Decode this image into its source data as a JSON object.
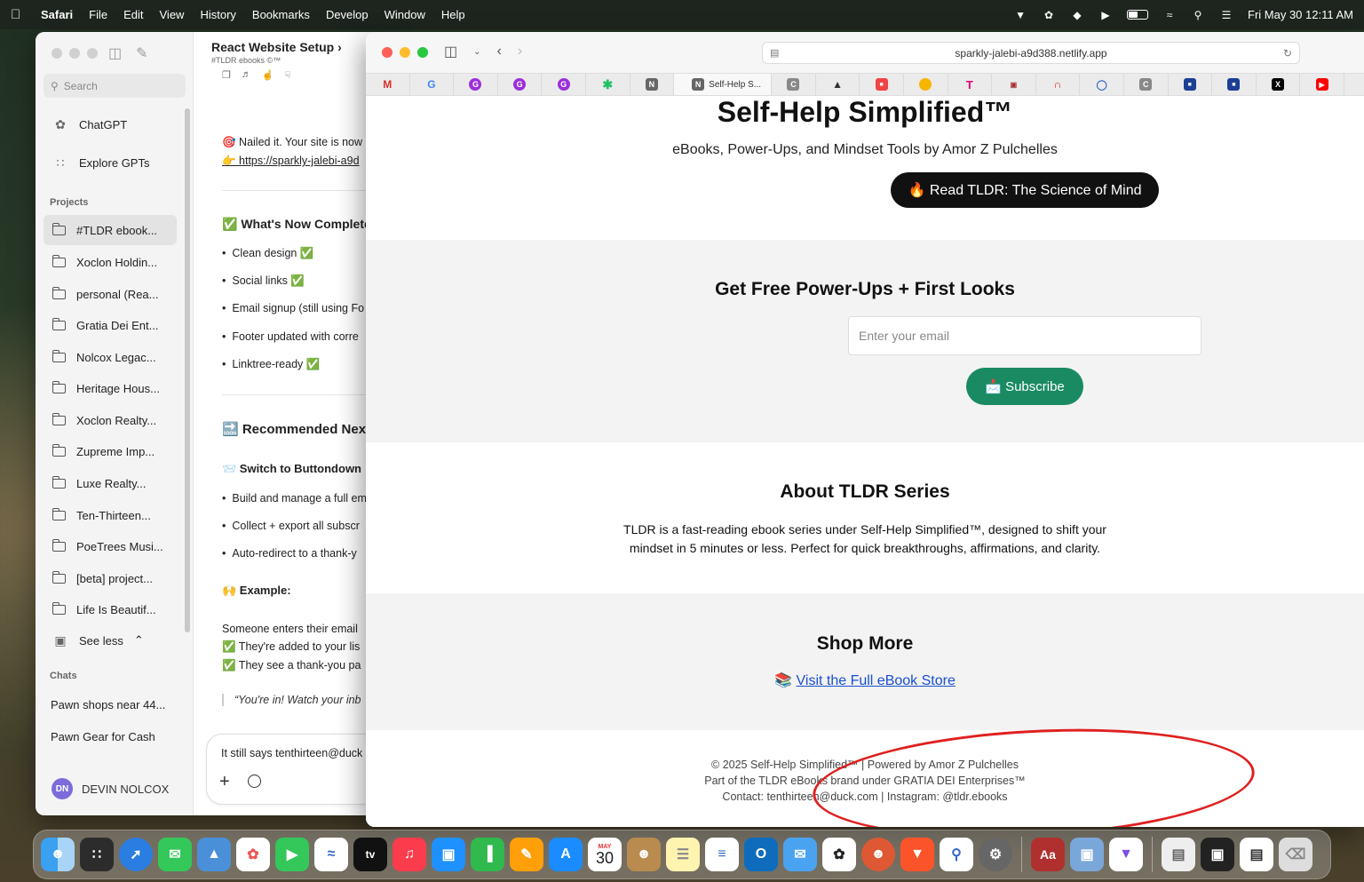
{
  "menubar": {
    "app": "Safari",
    "items": [
      "File",
      "Edit",
      "View",
      "History",
      "Bookmarks",
      "Develop",
      "Window",
      "Help"
    ],
    "clock": "Fri May 30  12:11 AM"
  },
  "chatgpt": {
    "search_placeholder": "Search",
    "nav": [
      "ChatGPT",
      "Explore GPTs"
    ],
    "projects_label": "Projects",
    "projects": [
      "#TLDR ebook...",
      "Xoclon Holdin...",
      "personal (Rea...",
      "Gratia Dei Ent...",
      "Nolcox Legac...",
      "Heritage Hous...",
      "Xoclon Realty...",
      "Zupreme Imp...",
      "Luxe Realty...",
      "Ten-Thirteen...",
      "PoeTrees Musi...",
      "[beta] project...",
      "Life Is Beautif..."
    ],
    "see_less": "See less",
    "chats_label": "Chats",
    "chats": [
      "Pawn shops near 44...",
      "Pawn Gear for Cash"
    ],
    "user_initials": "DN",
    "user_name": "DEVIN NOLCOX",
    "conversation_title": "React Website Setup",
    "conversation_sub": "#TLDR ebooks ©™",
    "lines": {
      "nailed": "🎯 Nailed it. Your site is now",
      "link": "👉 https://sparkly-jalebi-a9d",
      "complete_heading": "✅ What's Now Complete",
      "b1": "Clean design ✅",
      "b2": "Social links ✅",
      "b3": "Email signup (still using Fo",
      "b4": "Footer updated with corre",
      "b5": "Linktree-ready ✅",
      "next_heading": "🔜 Recommended Nex",
      "switch_heading": "📨 Switch to Buttondown",
      "b6": "Build and manage a full em",
      "b7": "Collect + export all subscr",
      "b8": "Auto-redirect to a thank-y",
      "example_heading": "🙌 Example:",
      "e1": "Someone enters their email",
      "e2": "✅ They're added to your lis",
      "e3": "✅ They see a thank-you pa",
      "quote": "“You're in! Watch your inb"
    },
    "input_text": "It still says tenthirteen@duck"
  },
  "safari": {
    "url": "sparkly-jalebi-a9d388.netlify.app",
    "active_tab": "Self-Help S..."
  },
  "site": {
    "title": "Self-Help Simplified™",
    "tagline": "eBooks, Power-Ups, and Mindset Tools by Amor Z Pulchelles",
    "cta": "🔥 Read TLDR: The Science of Mind",
    "signup_heading": "Get Free Power-Ups + First Looks",
    "email_placeholder": "Enter your email",
    "subscribe": "📩 Subscribe",
    "about_heading": "About TLDR Series",
    "about_line1": "TLDR is a fast-reading ebook series under Self-Help Simplified™, designed to shift your",
    "about_line2": "mindset in 5 minutes or less. Perfect for quick breakthroughs, affirmations, and clarity.",
    "shop_heading": "Shop More",
    "shop_icon": "📚",
    "shop_link": "Visit the Full eBook Store",
    "footer1": "© 2025 Self-Help Simplified™ | Powered by Amor Z Pulchelles",
    "footer2": "Part of the TLDR eBooks brand under GRATIA DEI Enterprises™",
    "footer3": "Contact: tenthirteen@duck.com | Instagram: @tldr.ebooks"
  },
  "dock": {
    "calendar_month": "MAY",
    "calendar_day": "30"
  },
  "colors": {
    "accent_green": "#1a8a63",
    "link_blue": "#1a4fd1",
    "annotation_red": "#e02020"
  }
}
